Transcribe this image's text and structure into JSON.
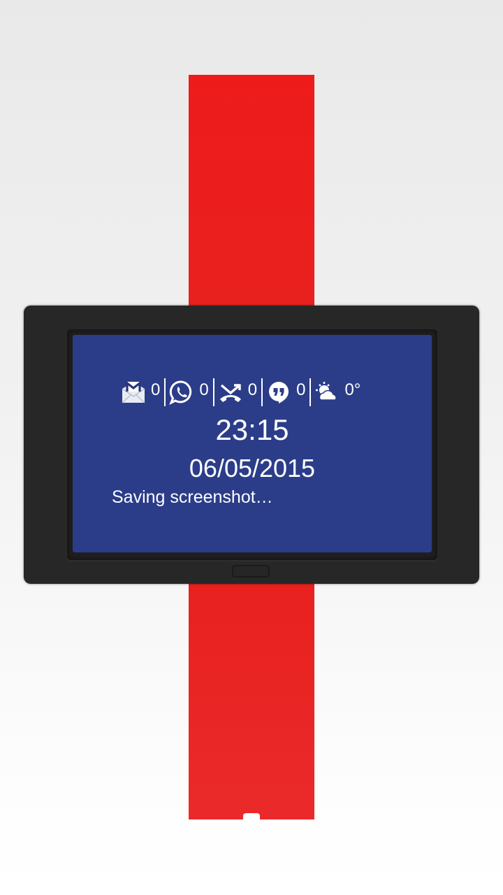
{
  "watch": {
    "status_icons": [
      {
        "icon": "gmail-icon",
        "count": "0"
      },
      {
        "icon": "whatsapp-icon",
        "count": "0"
      },
      {
        "icon": "missed-call-icon",
        "count": "0"
      },
      {
        "icon": "hangouts-icon",
        "count": "0"
      },
      {
        "icon": "weather-icon",
        "count": "0°"
      }
    ],
    "time": "23:15",
    "date": "06/05/2015",
    "notification": "Saving screenshot…"
  },
  "colors": {
    "strap": "#ec1f1f",
    "case": "#272727",
    "screen": "#2b3d89",
    "text": "#ffffff"
  }
}
